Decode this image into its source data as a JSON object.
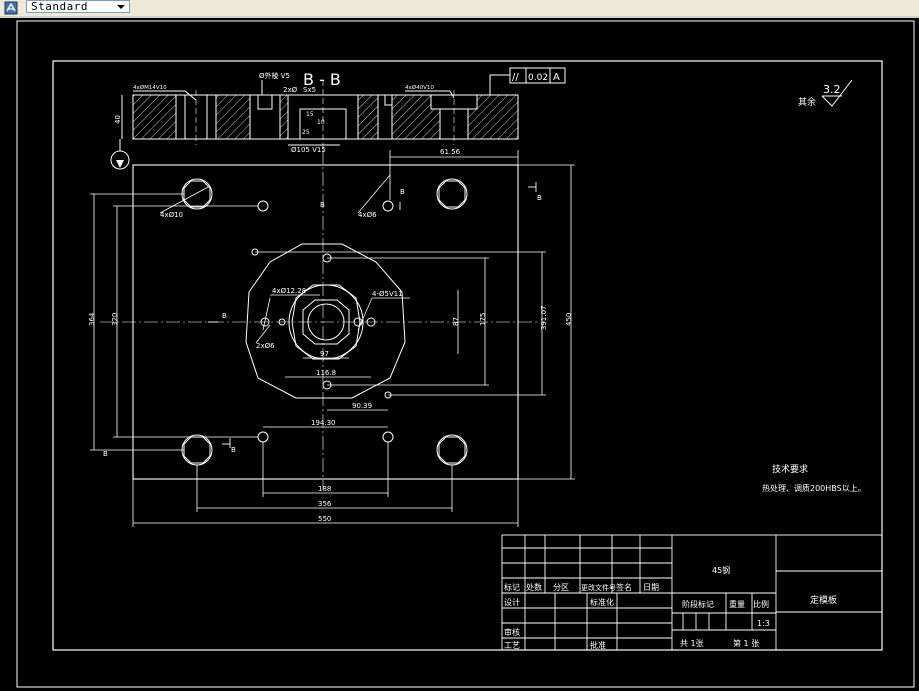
{
  "toolbar": {
    "text_style": "Standard",
    "style_icon": "text-style-icon",
    "dropdown_icon": "chevron-down-icon"
  },
  "drawing": {
    "section_title": "B - B",
    "section_marks": [
      "B",
      "B",
      "B",
      "B",
      "B",
      "B"
    ],
    "flatness_symbol": "//",
    "flatness_tolerance": "0.02",
    "datum": "A",
    "roughness_label": "其余",
    "roughness_value": "3.2",
    "sec_hole_note": "4xØM14V10",
    "sec_hole_note2": "4xØ40V10",
    "sec_dim_top": "Ø外棱 V5",
    "sec_dim_ha": "2xØ",
    "sec_dim_hb": "Sx5",
    "sec_dim_bottom": "Ø105 V15",
    "sec_dim_height": "40",
    "sec_dim_s1": "15",
    "sec_dim_s2": "10",
    "sec_dim_s3": "25",
    "dim_61_56": "61.56",
    "note_4x_a": "4xØ10",
    "note_4x_b": "4xØ6",
    "note_4x_c": "4xØ12.28",
    "note_4x_d": "4-Ø5V11",
    "note_2x": "2xØ6",
    "dim_97": "97",
    "dim_116": "116.8",
    "dim_90": "90.39",
    "dim_194": "194.30",
    "dim_188": "188",
    "dim_356": "356",
    "dim_550": "550",
    "dim_364": "364",
    "dim_320": "320",
    "dim_87": "87",
    "dim_175": "175",
    "dim_391": "391.07",
    "dim_450": "450",
    "tech_req_title": "技术要求",
    "tech_req_text": "热处理、调质200HBS以上。",
    "title_block": {
      "h_mark": "标记",
      "h_count": "处数",
      "h_zone": "分区",
      "h_doc": "更改文件号",
      "h_sign": "签名",
      "h_date": "日期",
      "design": "设计",
      "std": "标准化",
      "check": "审核",
      "process": "工艺",
      "approve": "批准",
      "material": "45钢",
      "stage": "阶段标记",
      "weight": "重量",
      "scale_label": "比例",
      "scale": "1:3",
      "total_sheets": "共 1张",
      "sheet_no": "第 1 张",
      "part_name": "定模板"
    }
  }
}
